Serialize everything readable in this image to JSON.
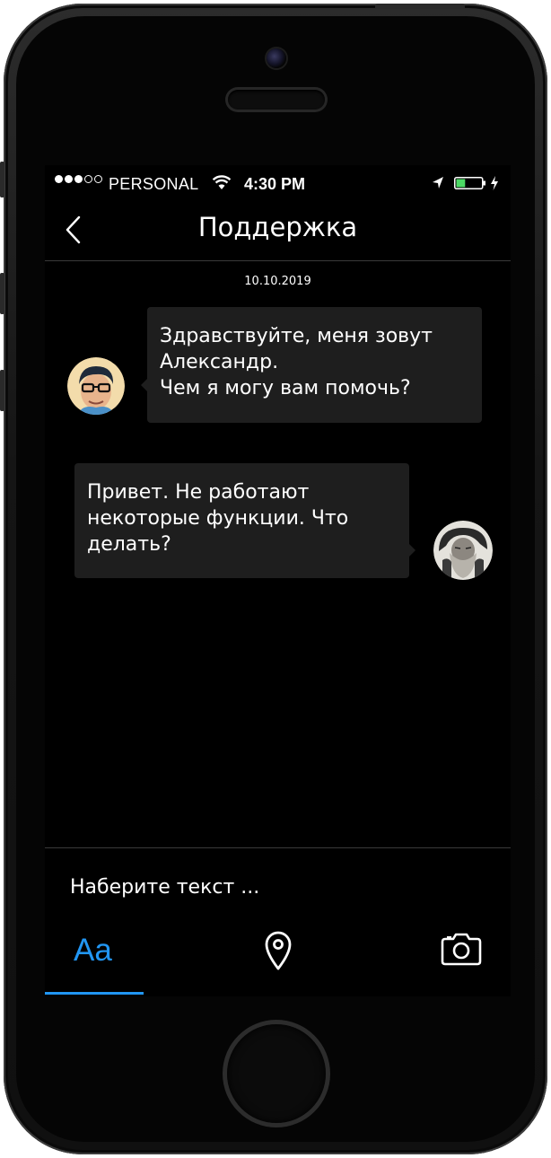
{
  "status_bar": {
    "carrier": "PERSONAL",
    "time": "4:30 PM",
    "signal_bars": 3,
    "signal_total": 5,
    "battery_level": 0.35,
    "battery_color": "#4cd964"
  },
  "nav": {
    "back_icon": "chevron-left-icon",
    "title": "Поддержка"
  },
  "chat": {
    "date": "10.10.2019",
    "messages": [
      {
        "sender": "support",
        "lines": [
          "Здравствуйте, меня зовут",
          "Александр.",
          "Чем я могу вам помочь?"
        ]
      },
      {
        "sender": "user",
        "lines": [
          "Привет. Не работают",
          "некоторые функции. Что",
          "делать?"
        ]
      }
    ]
  },
  "composer": {
    "placeholder": "Наберите текст ...",
    "text_tool_label": "Aa",
    "location_icon": "map-pin-icon",
    "camera_icon": "camera-icon"
  },
  "colors": {
    "accent": "#2196f3",
    "bubble": "#1e1e1e",
    "background": "#000000"
  }
}
